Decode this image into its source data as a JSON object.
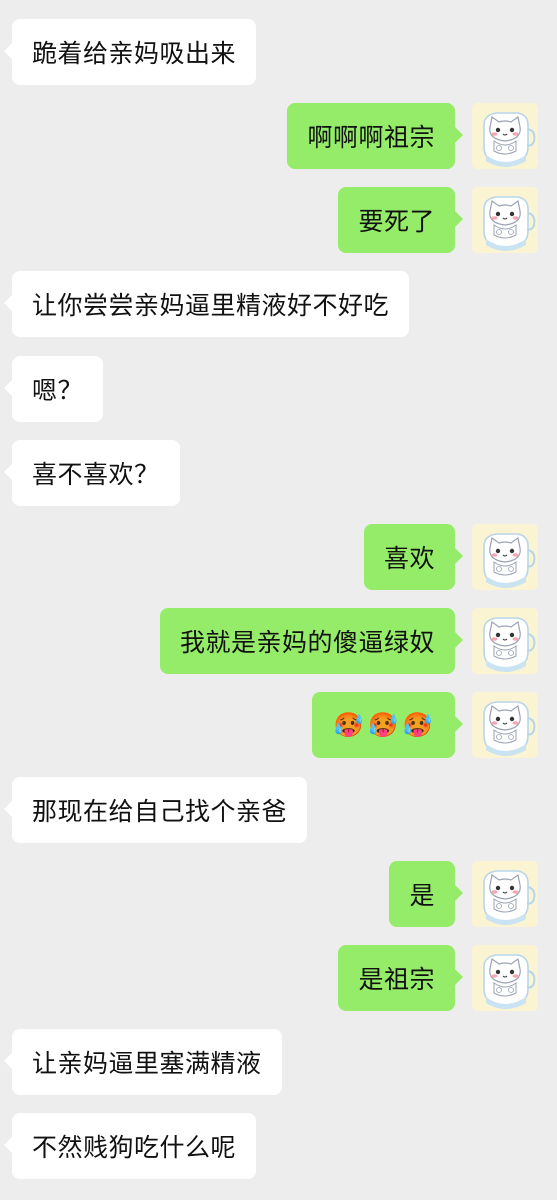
{
  "messages": [
    {
      "direction": "in",
      "text": "跪着给亲妈吸出来"
    },
    {
      "direction": "out",
      "text": "啊啊啊祖宗",
      "avatar_icon": "cat-in-cup-avatar-icon"
    },
    {
      "direction": "out",
      "text": "要死了",
      "avatar_icon": "cat-in-cup-avatar-icon"
    },
    {
      "direction": "in",
      "text": "让你尝尝亲妈逼里精液好不好吃"
    },
    {
      "direction": "in",
      "text": "嗯？"
    },
    {
      "direction": "in",
      "text": "喜不喜欢？"
    },
    {
      "direction": "out",
      "text": "喜欢",
      "avatar_icon": "cat-in-cup-avatar-icon"
    },
    {
      "direction": "out",
      "text": "我就是亲妈的傻逼绿奴",
      "avatar_icon": "cat-in-cup-avatar-icon"
    },
    {
      "direction": "out",
      "emojis": [
        "🥵",
        "🥵",
        "🥵"
      ],
      "emoji_icon": "hot-face-emoji-icon",
      "avatar_icon": "cat-in-cup-avatar-icon"
    },
    {
      "direction": "in",
      "text": "那现在给自己找个亲爸"
    },
    {
      "direction": "out",
      "text": "是",
      "avatar_icon": "cat-in-cup-avatar-icon"
    },
    {
      "direction": "out",
      "text": "是祖宗",
      "avatar_icon": "cat-in-cup-avatar-icon"
    },
    {
      "direction": "in",
      "text": "让亲妈逼里塞满精液"
    },
    {
      "direction": "in",
      "text": "不然贱狗吃什么呢"
    }
  ],
  "colors": {
    "background": "#ededed",
    "incoming_bubble": "#ffffff",
    "outgoing_bubble": "#95ec69",
    "text": "#111111",
    "avatar_background": "#fbf4d2"
  }
}
